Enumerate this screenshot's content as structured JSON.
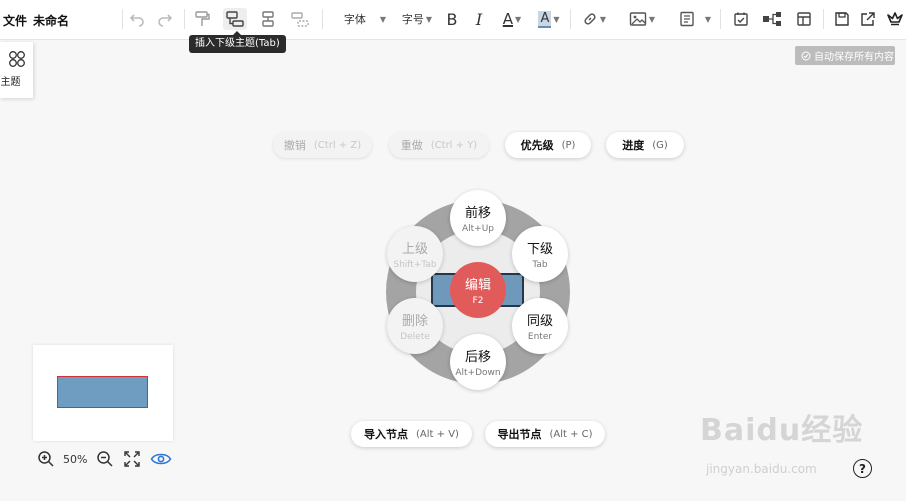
{
  "toolbar": {
    "file_label": "文件",
    "doc_title": "未命名",
    "font_label": "字体",
    "size_label": "字号",
    "bold_label": "B",
    "italic_label": "I",
    "font_color_label": "A",
    "highlight_label": "A"
  },
  "tooltip": "插入下级主题(Tab)",
  "autosave": "自动保存所有内容",
  "topic_panel": {
    "label": "主题"
  },
  "pills": {
    "undo": {
      "label": "撤销",
      "hint": "(Ctrl + Z)"
    },
    "redo": {
      "label": "重做",
      "hint": "(Ctrl + Y)"
    },
    "priority": {
      "label": "优先级",
      "hint": "(P)"
    },
    "progress": {
      "label": "进度",
      "hint": "(G)"
    },
    "import": {
      "label": "导入节点",
      "hint": "(Alt + V)"
    },
    "export": {
      "label": "导出节点",
      "hint": "(Alt + C)"
    }
  },
  "radial": {
    "up": {
      "label": "前移",
      "shortcut": "Alt+Up"
    },
    "child": {
      "label": "下级",
      "shortcut": "Tab"
    },
    "sibling": {
      "label": "同级",
      "shortcut": "Enter"
    },
    "down": {
      "label": "后移",
      "shortcut": "Alt+Down"
    },
    "delete": {
      "label": "删除",
      "shortcut": "Delete"
    },
    "parent": {
      "label": "上级",
      "shortcut": "Shift+Tab"
    },
    "edit": {
      "label": "编辑",
      "shortcut": "F2"
    }
  },
  "zoom": {
    "percent": "50%"
  },
  "help": {
    "label": "?"
  },
  "watermark": {
    "brand": "Baidu经验",
    "url": "jingyan.baidu.com"
  },
  "colors": {
    "accent": "#e25b5b",
    "node_fill": "#6f99bb",
    "node_border": "#24374b"
  }
}
